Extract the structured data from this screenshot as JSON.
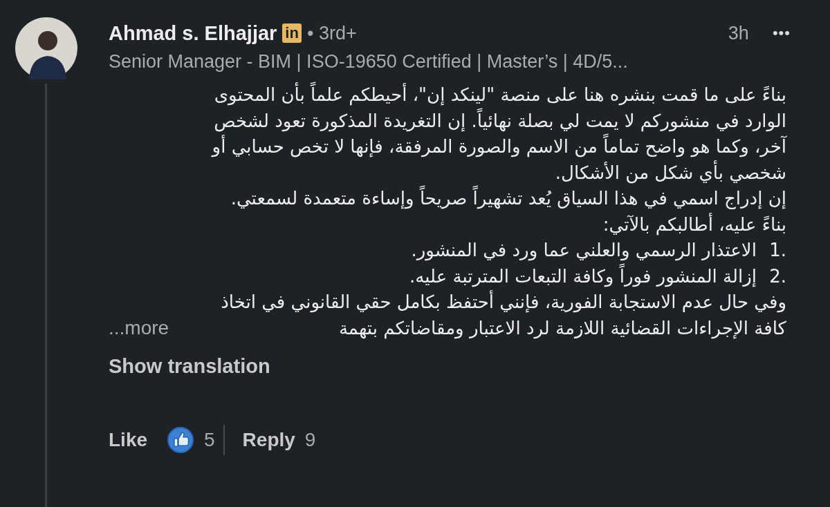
{
  "comment": {
    "author": "Ahmad s. Elhajjar",
    "badge": "in",
    "degree": "• 3rd+",
    "headline": "Senior Manager - BIM | ISO-19650 Certified | Master’s | 4D/5...",
    "time": "3h",
    "menu": "•••",
    "lines": [
      {
        "kind": "text",
        "text": "بناءً على ما قمت بنشره هنا على منصة \"لينكد إن\"، أحيطكم علماً بأن المحتوى"
      },
      {
        "kind": "text",
        "text": "الوارد في منشوركم لا يمت لي بصلة نهائياً. إن التغريدة المذكورة تعود لشخص"
      },
      {
        "kind": "text",
        "text": "آخر، وكما هو واضح تماماً من الاسم والصورة المرفقة، فإنها لا تخص حسابي أو"
      },
      {
        "kind": "text",
        "text": "شخصي بأي شكل من الأشكال."
      },
      {
        "kind": "text",
        "text": "إن إدراج اسمي في هذا السياق يُعد تشهيراً صريحاً وإساءة متعمدة لسمعتي."
      },
      {
        "kind": "text",
        "text": "بناءً عليه، أطالبكم بالآتي:"
      },
      {
        "kind": "numbered",
        "number": "1.",
        "text": "الاعتذار الرسمي والعلني عما ورد في المنشور."
      },
      {
        "kind": "numbered",
        "number": "2.",
        "text": "إزالة المنشور فوراً وكافة التبعات المترتبة عليه."
      },
      {
        "kind": "text",
        "text": "وفي حال عدم الاستجابة الفورية، فإنني أحتفظ بكامل حقي القانوني في اتخاذ"
      },
      {
        "kind": "text",
        "text": "كافة الإجراءات القضائية اللازمة لرد الاعتبار ومقاضاتكم بتهمة"
      }
    ],
    "more": "...more",
    "translation": "Show translation",
    "like": "Like",
    "like_count": "5",
    "reply": "Reply",
    "reply_count": "9"
  }
}
